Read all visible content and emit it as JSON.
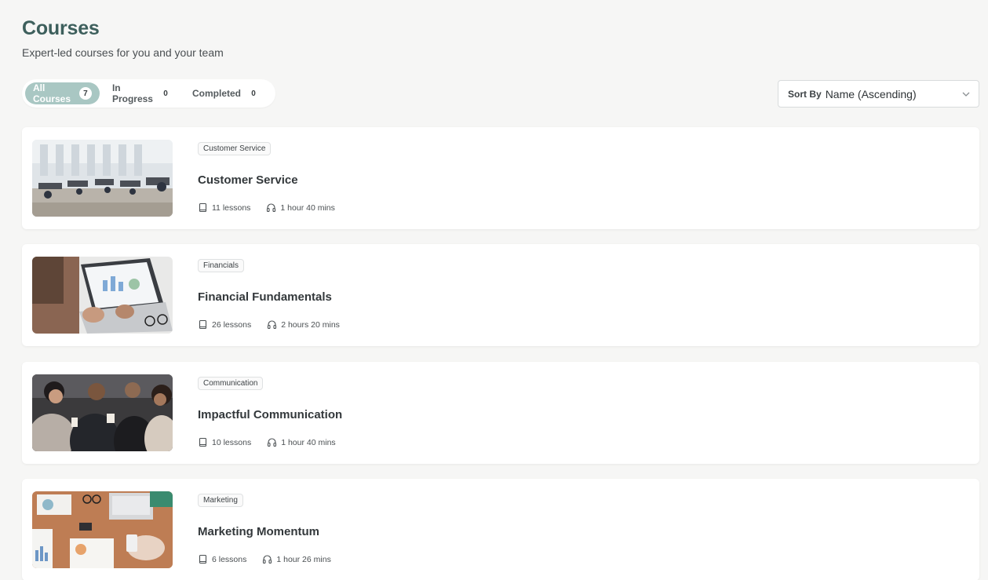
{
  "header": {
    "title": "Courses",
    "subtitle": "Expert-led courses for you and your team"
  },
  "tabs": [
    {
      "label": "All Courses",
      "count": "7",
      "active": true
    },
    {
      "label": "In Progress",
      "count": "0",
      "active": false
    },
    {
      "label": "Completed",
      "count": "0",
      "active": false
    }
  ],
  "sort": {
    "label": "Sort By",
    "value": "Name (Ascending)"
  },
  "courses": [
    {
      "tag": "Customer Service",
      "title": "Customer Service",
      "lessons": "11 lessons",
      "duration": "1 hour 40 mins",
      "image": "office-workspace"
    },
    {
      "tag": "Financials",
      "title": "Financial Fundamentals",
      "lessons": "26 lessons",
      "duration": "2 hours 20 mins",
      "image": "laptop-charts"
    },
    {
      "tag": "Communication",
      "title": "Impactful Communication",
      "lessons": "10 lessons",
      "duration": "1 hour 40 mins",
      "image": "people-group"
    },
    {
      "tag": "Marketing",
      "title": "Marketing Momentum",
      "lessons": "6 lessons",
      "duration": "1 hour 26 mins",
      "image": "desk-reports"
    }
  ],
  "colors": {
    "accent": "#3d5f5c",
    "active_tab": "#a9c7c3",
    "background": "#f6f6f5"
  }
}
